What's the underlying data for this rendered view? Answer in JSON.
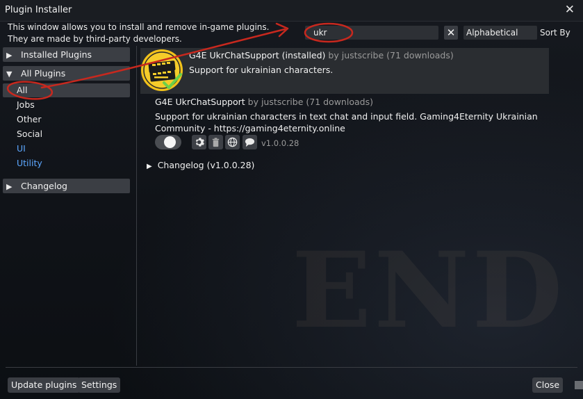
{
  "window": {
    "title": "Plugin Installer"
  },
  "description": [
    "This window allows you to install and remove in-game plugins.",
    "They are made by third-party developers."
  ],
  "search": {
    "value": "ukr"
  },
  "sort": {
    "selected": "Alphabetical",
    "label": "Sort By"
  },
  "sidebar": {
    "installed": "Installed Plugins",
    "all": "All Plugins",
    "sub_items": [
      "All",
      "Jobs",
      "Other",
      "Social",
      "UI",
      "Utility"
    ],
    "changelog": "Changelog"
  },
  "plugin_header": {
    "name": "G4E UkrChatSupport (installed)",
    "by": "by justscribe (71 downloads)",
    "description": "Support for ukrainian characters."
  },
  "plugin_detail": {
    "name": "G4E UkrChatSupport",
    "by": "by justscribe (71 downloads)",
    "description": "Support for ukrainian characters in text chat and input field. Gaming4Eternity Ukrainian Community - https://gaming4eternity.online",
    "version": "v1.0.0.28",
    "changelog": "Changelog (v1.0.0.28)"
  },
  "icons": [
    "close-icon",
    "clear-icon",
    "gear-icon",
    "trash-icon",
    "globe-icon",
    "chat-icon"
  ],
  "footer": {
    "update": "Update plugins",
    "settings": "Settings",
    "close": "Close"
  },
  "background_text": "END",
  "colors": {
    "accent_blue": "#5ca7ff",
    "annotation_red": "#c8281e",
    "enabled_check": "#6ad04a"
  }
}
